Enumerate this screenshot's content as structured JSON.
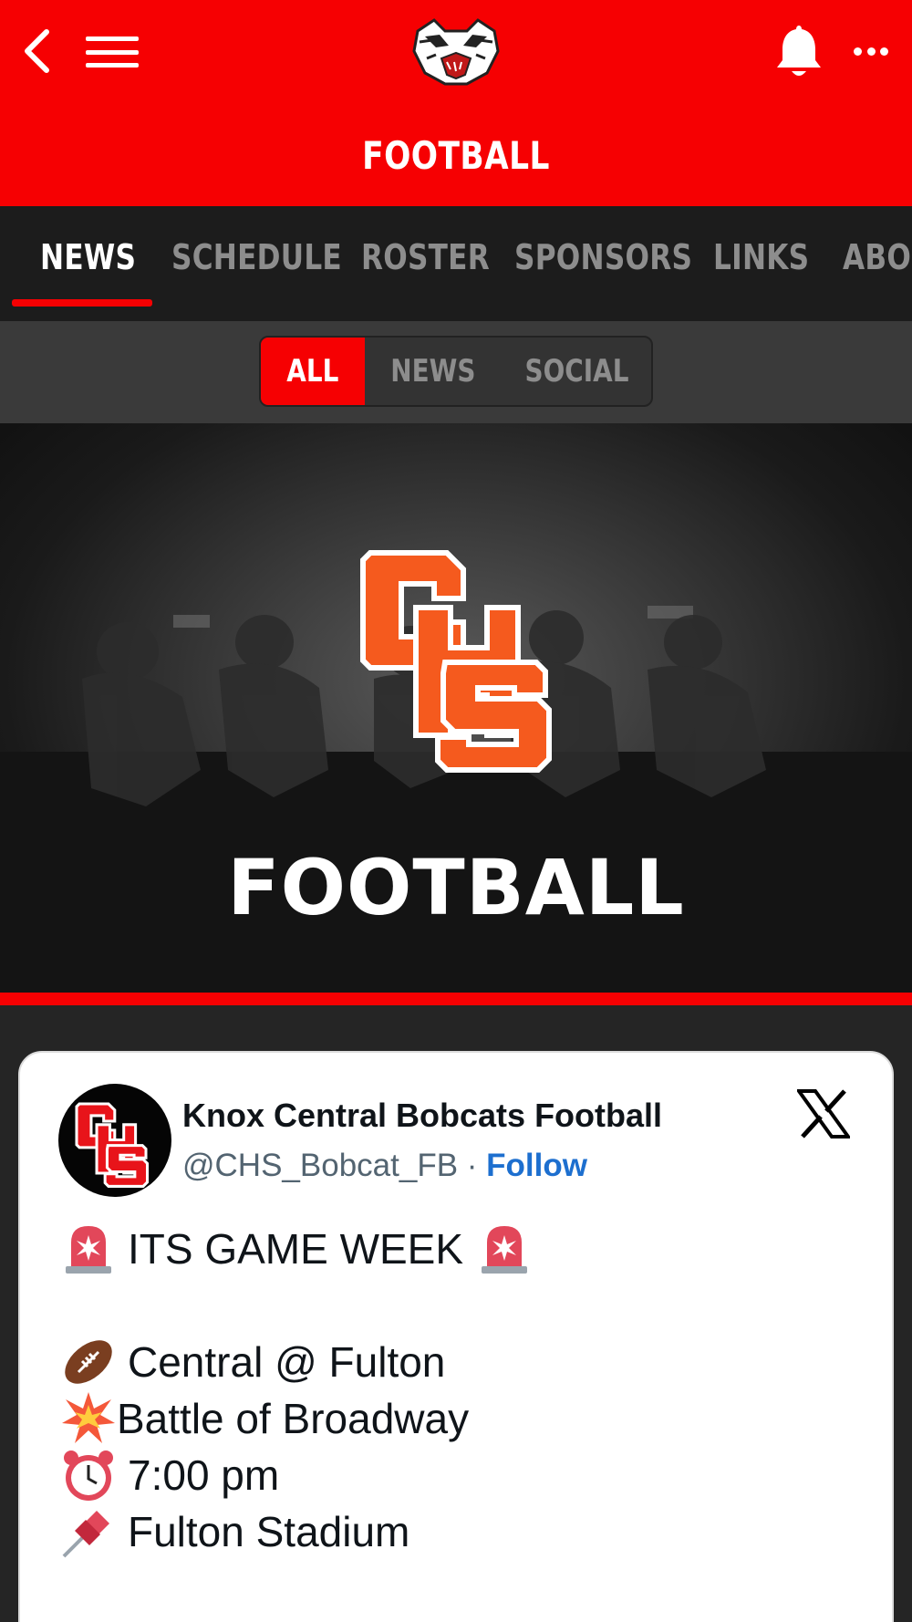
{
  "header": {
    "title": "FOOTBALL",
    "accent_color": "#f60002",
    "icons": [
      "back-icon",
      "menu-icon",
      "bobcat-logo",
      "bell-icon",
      "more-icon"
    ]
  },
  "tabs": [
    {
      "label": "NEWS",
      "active": true
    },
    {
      "label": "SCHEDULE",
      "active": false
    },
    {
      "label": "ROSTER",
      "active": false
    },
    {
      "label": "SPONSORS",
      "active": false
    },
    {
      "label": "LINKS",
      "active": false
    },
    {
      "label": "ABOUT",
      "active": false
    }
  ],
  "filter": {
    "options": [
      "ALL",
      "NEWS",
      "SOCIAL"
    ],
    "selected": "ALL"
  },
  "hero": {
    "logo_text": "CHS",
    "word": "FOOTBALL"
  },
  "tweet": {
    "author_name": "Knox Central Bobcats Football",
    "handle": "@CHS_Bobcat_FB",
    "separator": "·",
    "follow_label": "Follow",
    "source_icon": "x-logo-icon",
    "lines": [
      {
        "emoji": "siren-icon",
        "text": "ITS GAME WEEK",
        "trailing_emoji": "siren-icon"
      },
      {
        "emoji": "football-icon",
        "text": "Central @ Fulton"
      },
      {
        "emoji": "collision-icon",
        "text": "Battle of Broadway"
      },
      {
        "emoji": "alarm-clock-icon",
        "text": "7:00 pm"
      },
      {
        "emoji": "pushpin-icon",
        "text": "Fulton Stadium"
      }
    ]
  }
}
